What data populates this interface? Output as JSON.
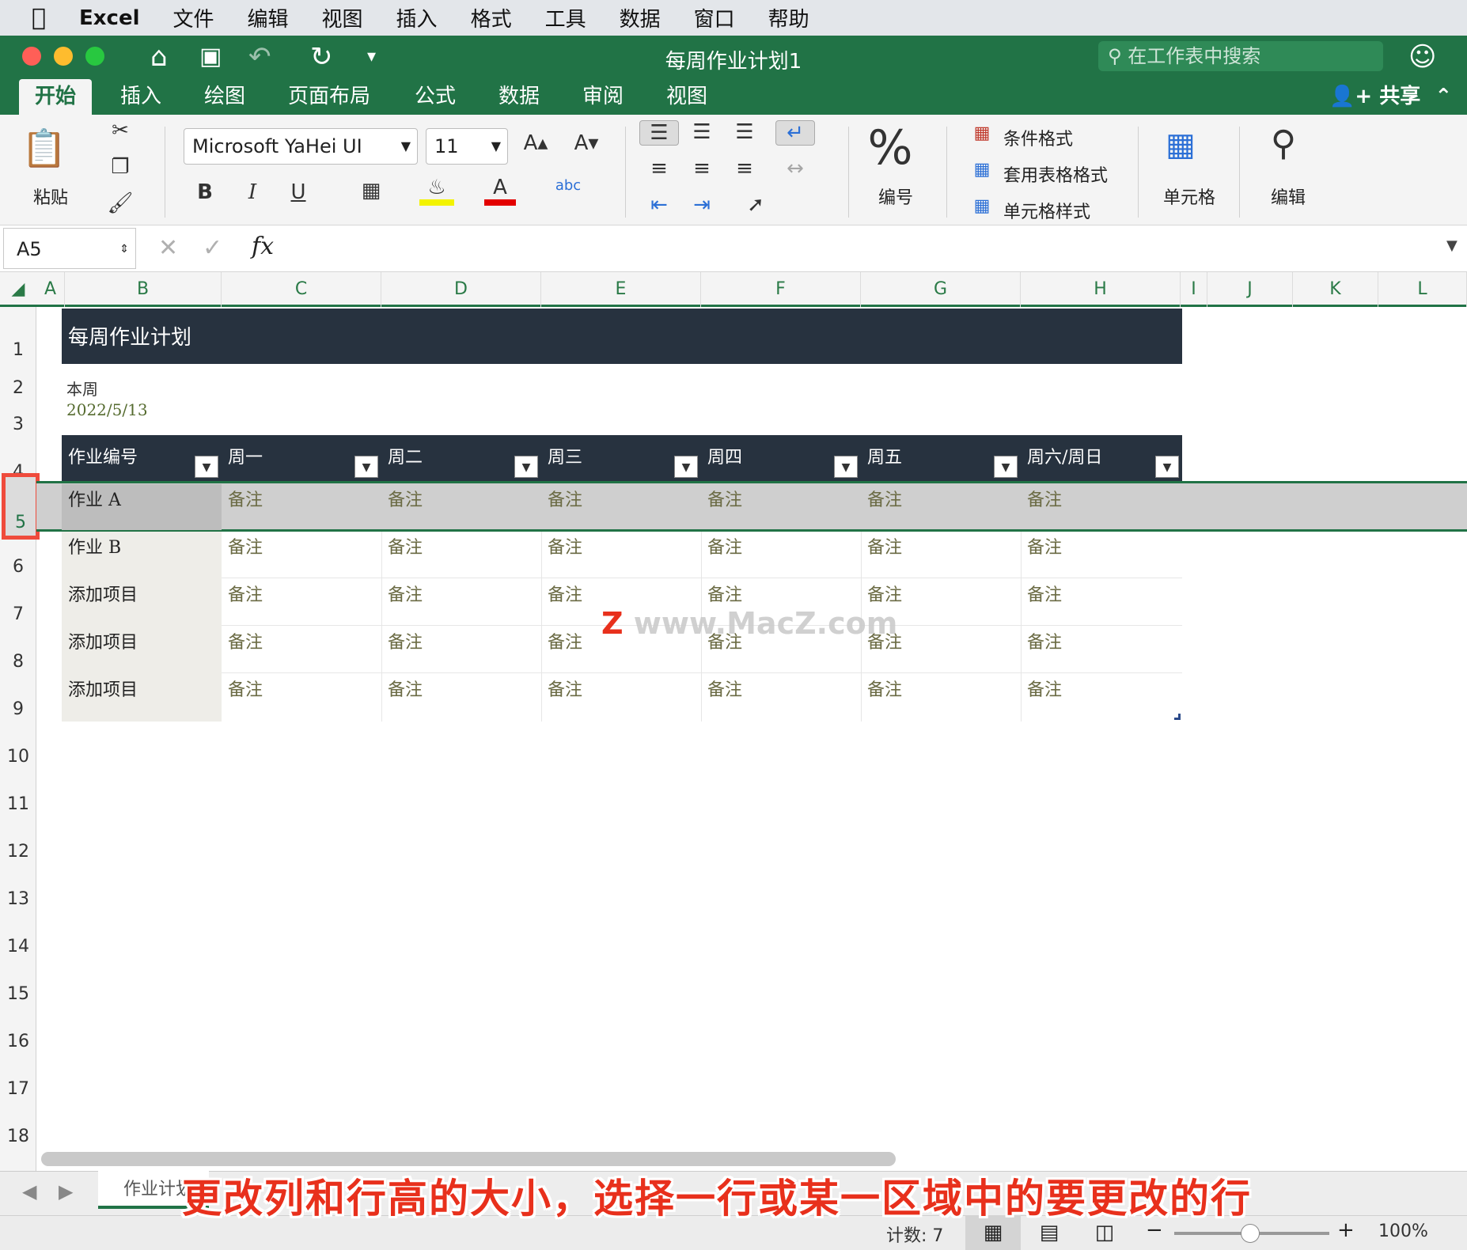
{
  "menubar": {
    "app": "Excel",
    "items": [
      "文件",
      "编辑",
      "视图",
      "插入",
      "格式",
      "工具",
      "数据",
      "窗口",
      "帮助"
    ]
  },
  "window": {
    "title": "每周作业计划1",
    "search_placeholder": "在工作表中搜索"
  },
  "ribbon_tabs": [
    "开始",
    "插入",
    "绘图",
    "页面布局",
    "公式",
    "数据",
    "审阅",
    "视图"
  ],
  "active_tab": "开始",
  "share_label": "共享",
  "ribbon": {
    "paste_label": "粘贴",
    "font_name": "Microsoft YaHei UI",
    "font_size": "11",
    "bold": "B",
    "italic": "I",
    "underline": "U",
    "number_label": "编号",
    "percent": "%",
    "cond_format": "条件格式",
    "table_format": "套用表格格式",
    "cell_style": "单元格样式",
    "cells_label": "单元格",
    "edit_label": "编辑"
  },
  "formula_bar": {
    "name_box": "A5",
    "fx": "fx"
  },
  "columns": [
    "A",
    "B",
    "C",
    "D",
    "E",
    "F",
    "G",
    "H",
    "I",
    "J",
    "K",
    "L"
  ],
  "rows": [
    "1",
    "2",
    "3",
    "4",
    "5",
    "6",
    "7",
    "8",
    "9",
    "10",
    "11",
    "12",
    "13",
    "14",
    "15",
    "16",
    "17",
    "18"
  ],
  "sheet": {
    "title": "每周作业计划",
    "week_label": "本周",
    "week_date": "2022/5/13",
    "table_headers": [
      "作业编号",
      "周一",
      "周二",
      "周三",
      "周四",
      "周五",
      "周六/周日"
    ],
    "task_rows": [
      {
        "name": "作业 A",
        "notes": [
          "备注",
          "备注",
          "备注",
          "备注",
          "备注",
          "备注"
        ]
      },
      {
        "name": "作业 B",
        "notes": [
          "备注",
          "备注",
          "备注",
          "备注",
          "备注",
          "备注"
        ]
      },
      {
        "name": "添加项目",
        "notes": [
          "备注",
          "备注",
          "备注",
          "备注",
          "备注",
          "备注"
        ]
      },
      {
        "name": "添加项目",
        "notes": [
          "备注",
          "备注",
          "备注",
          "备注",
          "备注",
          "备注"
        ]
      },
      {
        "name": "添加项目",
        "notes": [
          "备注",
          "备注",
          "备注",
          "备注",
          "备注",
          "备注"
        ]
      }
    ]
  },
  "sheet_tab": "作业计划",
  "status": {
    "count": "计数: 7",
    "zoom": "100%"
  },
  "caption": "更改列和行高的大小，选择一行或某一区域中的要更改的行",
  "watermark": "www.MacZ.com",
  "colors": {
    "excel_green": "#217346",
    "table_dark": "#27323f",
    "selection_gray": "#cfcfcf",
    "highlight_red": "#e8301c"
  }
}
